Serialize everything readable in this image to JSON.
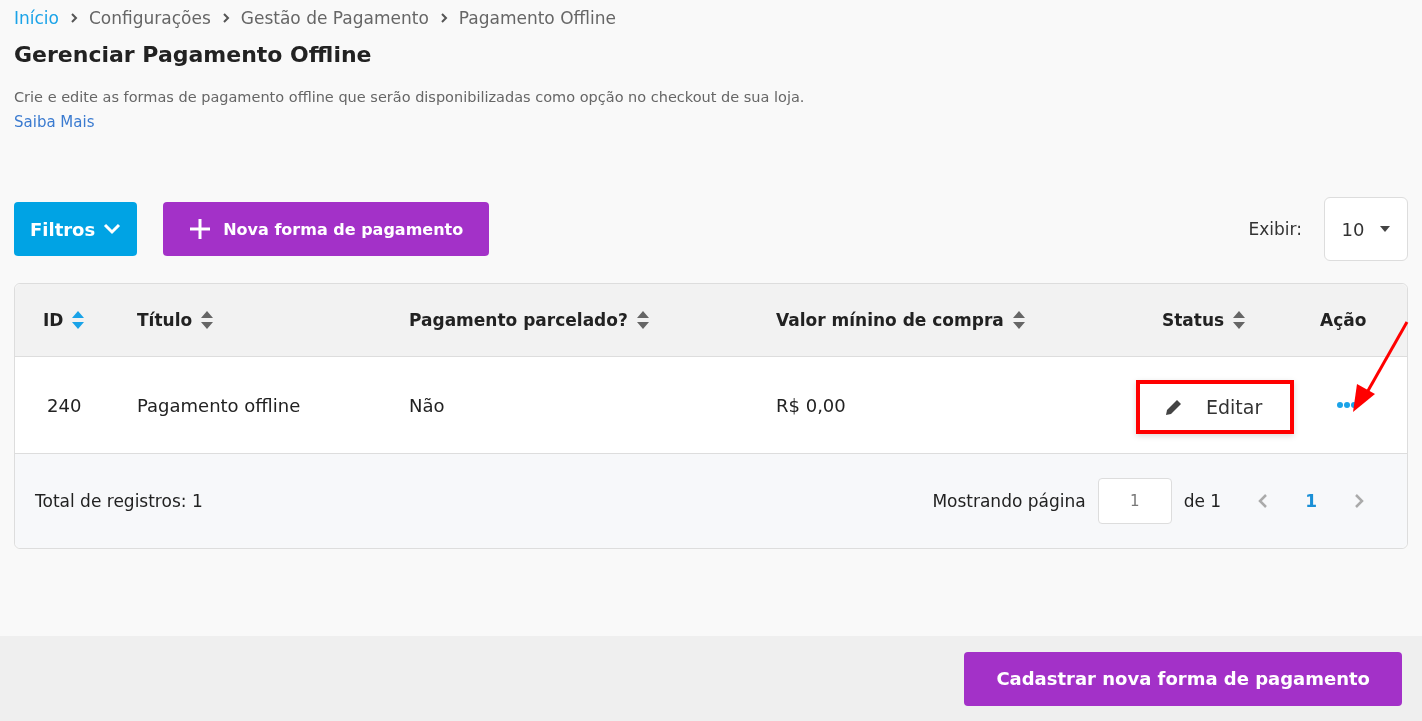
{
  "breadcrumb": [
    {
      "label": "Início",
      "link": true
    },
    {
      "label": "Configurações",
      "link": false
    },
    {
      "label": "Gestão de Pagamento",
      "link": false
    },
    {
      "label": "Pagamento Offline",
      "link": false
    }
  ],
  "page_title": "Gerenciar Pagamento Offline",
  "description": "Crie e edite as formas de pagamento offline que serão disponibilizadas como opção no checkout de sua loja.",
  "learn_more": "Saiba Mais",
  "toolbar": {
    "filters_button": "Filtros",
    "new_button": "Nova forma de pagamento",
    "show_label": "Exibir:",
    "page_size": "10"
  },
  "table": {
    "columns": [
      {
        "label": "ID",
        "sortable": true,
        "selected": true
      },
      {
        "label": "Título",
        "sortable": true,
        "selected": false
      },
      {
        "label": "Pagamento parcelado?",
        "sortable": true,
        "selected": false
      },
      {
        "label": "Valor mínino de compra",
        "sortable": true,
        "selected": false
      },
      {
        "label": "Status",
        "sortable": true,
        "selected": false
      },
      {
        "label": "Ação",
        "sortable": false
      }
    ],
    "rows": [
      {
        "id": "240",
        "title": "Pagamento offline",
        "installments": "Não",
        "min_value": "R$ 0,00",
        "menu_open": true,
        "menu_item": "Editar",
        "highlighted": true
      }
    ]
  },
  "pagination": {
    "total": "Total de registros: 1",
    "showing": "Mostrando página",
    "page_value": "1",
    "of": "de 1",
    "pages": [
      {
        "label": "1",
        "selected": true
      }
    ]
  },
  "footer_button": "Cadastrar nova forma de pagamento"
}
